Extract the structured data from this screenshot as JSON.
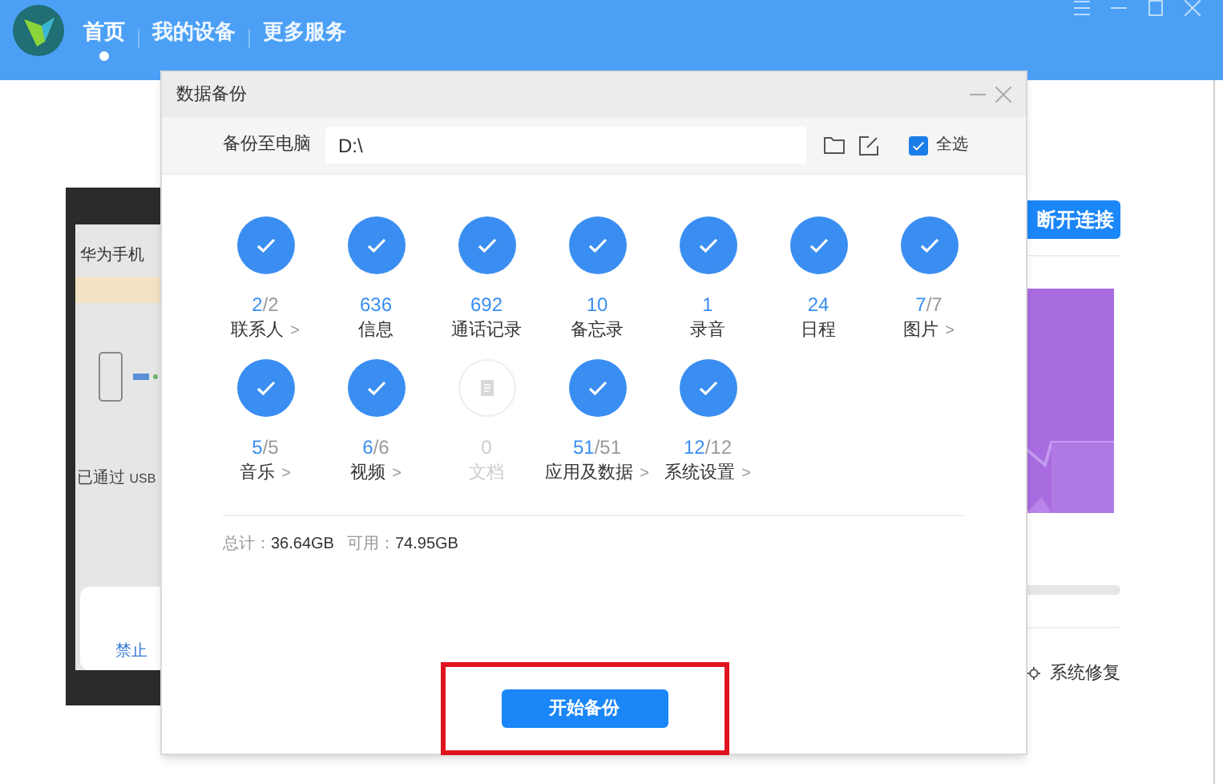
{
  "nav": [
    {
      "label": "首页",
      "selected": true
    },
    {
      "label": "我的设备",
      "selected": false
    },
    {
      "label": "更多服务",
      "selected": false
    }
  ],
  "phone": {
    "app_title": "华为手机",
    "status": "已通过",
    "status_suffix": "USB",
    "deny": "禁止"
  },
  "side": {
    "disconnect": "断开连接",
    "repair": "系统修复"
  },
  "dialog": {
    "title": "数据备份",
    "path_label": "备份至电脑",
    "path": "D:\\",
    "select_all": {
      "label": "全选",
      "checked": true
    },
    "items": [
      {
        "count": "2",
        "total": "/2",
        "label": "联系人",
        "arrow": ">",
        "selected": true
      },
      {
        "count": "636",
        "label": "信息",
        "selected": true
      },
      {
        "count": "692",
        "label": "通话记录",
        "selected": true
      },
      {
        "count": "10",
        "label": "备忘录",
        "selected": true
      },
      {
        "count": "1",
        "label": "录音",
        "selected": true
      },
      {
        "count": "24",
        "label": "日程",
        "selected": true
      },
      {
        "count": "7",
        "total": "/7",
        "label": "图片",
        "arrow": ">",
        "selected": true
      },
      {
        "count": "5",
        "total": "/5",
        "label": "音乐",
        "arrow": ">",
        "selected": true
      },
      {
        "count": "6",
        "total": "/6",
        "label": "视频",
        "arrow": ">",
        "selected": true
      },
      {
        "count": "0",
        "label": "文档",
        "selected": false
      },
      {
        "count": "51",
        "total": "/51",
        "label": "应用及数据",
        "arrow": ">",
        "selected": true
      },
      {
        "count": "12",
        "total": "/12",
        "label": "系统设置",
        "arrow": ">",
        "selected": true
      }
    ],
    "total_label": "总计：",
    "total_value": "36.64GB",
    "free_label": "可用：",
    "free_value": "74.95GB",
    "start_button": "开始备份"
  }
}
